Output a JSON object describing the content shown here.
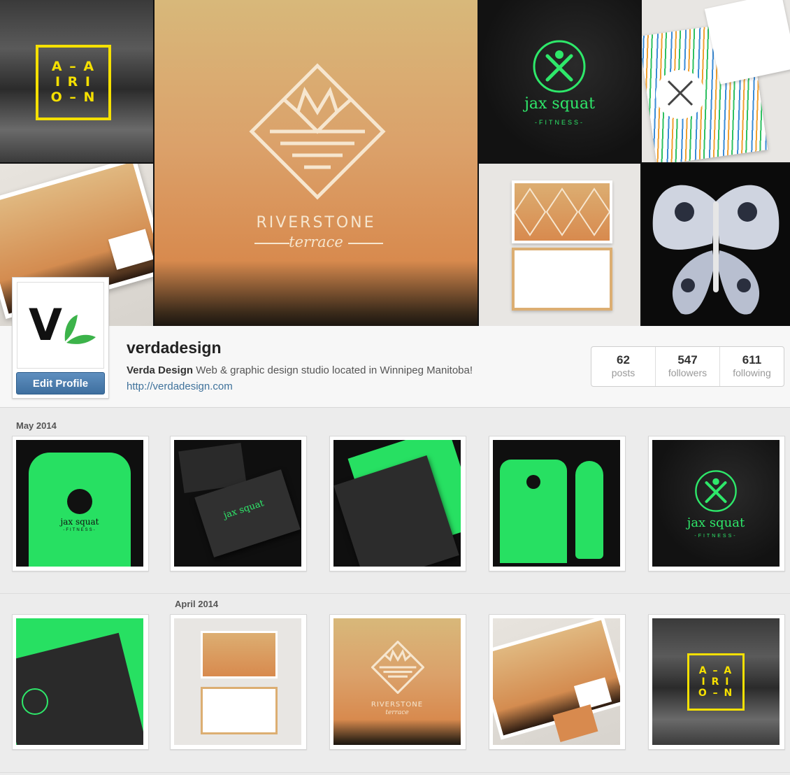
{
  "profile": {
    "username": "verdadesign",
    "full_name": "Verda Design",
    "bio": "Web & graphic design studio located in Winnipeg Manitoba!",
    "website": "http://verdadesign.com",
    "edit_button": "Edit Profile",
    "avatar_text": "V"
  },
  "stats": [
    {
      "value": "62",
      "label": "posts"
    },
    {
      "value": "547",
      "label": "followers"
    },
    {
      "value": "611",
      "label": "following"
    }
  ],
  "hero": {
    "airion_rows": [
      "A – A",
      "I R I",
      "O – N"
    ],
    "riverstone_title": "RIVERSTONE",
    "riverstone_sub": "terrace",
    "jax_title": "jax squat",
    "jax_sub": "-FITNESS-"
  },
  "sections": [
    {
      "label": "May 2014"
    },
    {
      "label": "April 2014"
    }
  ],
  "thumbs": {
    "jax_title": "jax squat",
    "jax_sub": "-FITNESS-",
    "riverstone_title": "RIVERSTONE",
    "riverstone_sub": "terrace",
    "airion_rows": [
      "A – A",
      "I R I",
      "O – N"
    ]
  },
  "colors": {
    "accent_green": "#2ee86a",
    "link_blue": "#3f729b",
    "airion_yellow": "#f5e000",
    "button_blue": "#4a7aaa"
  }
}
